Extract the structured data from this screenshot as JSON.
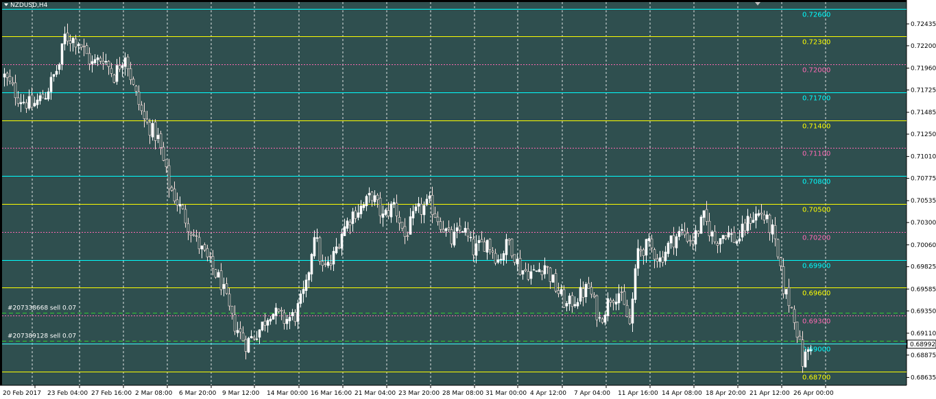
{
  "symbol_title": "NZDUSD,H4",
  "current_price": "0.68992",
  "colors": {
    "background": "#2f4f4f",
    "axis_bg": "#ffffff",
    "grid": "#ffffff",
    "bull": "#ffffff",
    "bear": "#ffe4e1",
    "yellow": "#ffff00",
    "cyan": "#00ffff",
    "pink": "#ff69b4",
    "order": "#32cd32",
    "label_text": "#ffffff",
    "axis_text": "#000000"
  },
  "orders": [
    {
      "label": "#207338668 sell 0.07",
      "price": 0.6933
    },
    {
      "label": "#207389128 sell 0.07",
      "price": 0.6903
    }
  ],
  "chart_data": {
    "type": "candlestick",
    "title": "NZDUSD,H4",
    "ylim": [
      0.6855,
      0.7267
    ],
    "grid": true,
    "y_ticks": [
      "0.72435",
      "0.72200",
      "0.71960",
      "0.71725",
      "0.71485",
      "0.71250",
      "0.71010",
      "0.70775",
      "0.70535",
      "0.70300",
      "0.70060",
      "0.69825",
      "0.69585",
      "0.69350",
      "0.69110",
      "0.68875",
      "0.68635"
    ],
    "x_ticks": [
      "20 Feb 2017",
      "23 Feb 04:00",
      "27 Feb 16:00",
      "2 Mar 08:00",
      "6 Mar 20:00",
      "9 Mar 12:00",
      "14 Mar 00:00",
      "16 Mar 16:00",
      "21 Mar 04:00",
      "23 Mar 20:00",
      "28 Mar 08:00",
      "31 Mar 00:00",
      "4 Apr 12:00",
      "7 Apr 04:00",
      "11 Apr 16:00",
      "14 Apr 08:00",
      "18 Apr 20:00",
      "21 Apr 12:00",
      "26 Apr 00:00"
    ],
    "levels": [
      {
        "price": 0.726,
        "label": "0.72600",
        "color": "cyan",
        "style": "solid"
      },
      {
        "price": 0.723,
        "label": "0.72300",
        "color": "yellow",
        "style": "solid"
      },
      {
        "price": 0.72,
        "label": "0.72000",
        "color": "pink",
        "style": "dotted"
      },
      {
        "price": 0.717,
        "label": "0.71700",
        "color": "cyan",
        "style": "solid"
      },
      {
        "price": 0.714,
        "label": "0.71400",
        "color": "yellow",
        "style": "solid"
      },
      {
        "price": 0.711,
        "label": "0.71100",
        "color": "pink",
        "style": "dotted"
      },
      {
        "price": 0.708,
        "label": "0.70800",
        "color": "cyan",
        "style": "solid"
      },
      {
        "price": 0.705,
        "label": "0.70500",
        "color": "yellow",
        "style": "solid"
      },
      {
        "price": 0.702,
        "label": "0.70200",
        "color": "pink",
        "style": "dotted"
      },
      {
        "price": 0.699,
        "label": "0.69900",
        "color": "cyan",
        "style": "solid"
      },
      {
        "price": 0.696,
        "label": "0.69600",
        "color": "yellow",
        "style": "solid"
      },
      {
        "price": 0.693,
        "label": "0.69300",
        "color": "pink",
        "style": "dotted"
      },
      {
        "price": 0.69,
        "label": "0.69000",
        "color": "cyan",
        "style": "solid"
      },
      {
        "price": 0.687,
        "label": "0.68700",
        "color": "yellow",
        "style": "solid"
      }
    ],
    "close_path": [
      [
        0,
        0.7187
      ],
      [
        5,
        0.7165
      ],
      [
        10,
        0.7155
      ],
      [
        15,
        0.7168
      ],
      [
        20,
        0.72
      ],
      [
        22,
        0.723
      ],
      [
        27,
        0.7225
      ],
      [
        32,
        0.72
      ],
      [
        36,
        0.7208
      ],
      [
        40,
        0.7188
      ],
      [
        44,
        0.7212
      ],
      [
        47,
        0.7175
      ],
      [
        51,
        0.714
      ],
      [
        56,
        0.712
      ],
      [
        60,
        0.707
      ],
      [
        65,
        0.704
      ],
      [
        70,
        0.701
      ],
      [
        75,
        0.6985
      ],
      [
        79,
        0.6965
      ],
      [
        83,
        0.6925
      ],
      [
        88,
        0.69
      ],
      [
        93,
        0.6915
      ],
      [
        97,
        0.6935
      ],
      [
        102,
        0.6925
      ],
      [
        106,
        0.693
      ],
      [
        110,
        0.696
      ],
      [
        113,
        0.702
      ],
      [
        116,
        0.698
      ],
      [
        119,
        0.6985
      ],
      [
        123,
        0.702
      ],
      [
        127,
        0.704
      ],
      [
        131,
        0.7048
      ],
      [
        134,
        0.706
      ],
      [
        138,
        0.7035
      ],
      [
        142,
        0.705
      ],
      [
        146,
        0.7015
      ],
      [
        150,
        0.704
      ],
      [
        155,
        0.705
      ],
      [
        159,
        0.703
      ],
      [
        163,
        0.701
      ],
      [
        167,
        0.7025
      ],
      [
        171,
        0.7
      ],
      [
        176,
        0.701
      ],
      [
        180,
        0.699
      ],
      [
        184,
        0.701
      ],
      [
        188,
        0.698
      ],
      [
        193,
        0.6975
      ],
      [
        197,
        0.6985
      ],
      [
        201,
        0.696
      ],
      [
        205,
        0.694
      ],
      [
        209,
        0.695
      ],
      [
        213,
        0.696
      ],
      [
        217,
        0.6925
      ],
      [
        221,
        0.695
      ],
      [
        224,
        0.6955
      ],
      [
        228,
        0.692
      ],
      [
        231,
        0.7
      ],
      [
        235,
        0.7005
      ],
      [
        239,
        0.699
      ],
      [
        243,
        0.701
      ],
      [
        247,
        0.702
      ],
      [
        251,
        0.701
      ],
      [
        255,
        0.7035
      ],
      [
        259,
        0.701
      ],
      [
        263,
        0.702
      ],
      [
        267,
        0.701
      ],
      [
        272,
        0.7035
      ],
      [
        276,
        0.704
      ],
      [
        280,
        0.702
      ],
      [
        284,
        0.696
      ],
      [
        288,
        0.693
      ],
      [
        291,
        0.688
      ],
      [
        294,
        0.6899
      ]
    ]
  }
}
